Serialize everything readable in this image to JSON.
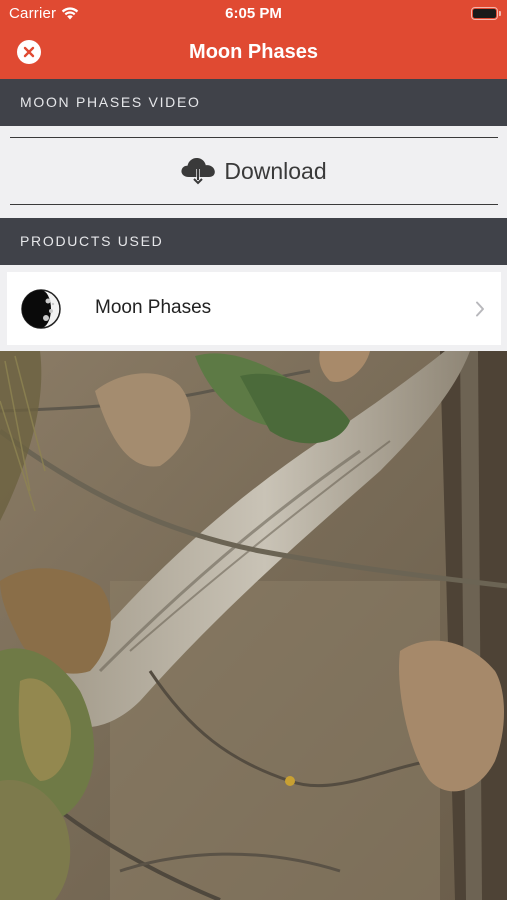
{
  "status_bar": {
    "carrier": "Carrier",
    "time": "6:05 PM"
  },
  "navbar": {
    "title": "Moon Phases",
    "close_icon": "close-icon"
  },
  "sections": {
    "video_header": "MOON PHASES VIDEO",
    "products_header": "PRODUCTS USED"
  },
  "download": {
    "label": "Download",
    "icon": "cloud-download-icon"
  },
  "products": [
    {
      "label": "Moon Phases",
      "icon": "moon-phase-icon"
    }
  ],
  "colors": {
    "accent": "#e04a32",
    "section_header": "#404249",
    "background": "#f0f0f2"
  }
}
